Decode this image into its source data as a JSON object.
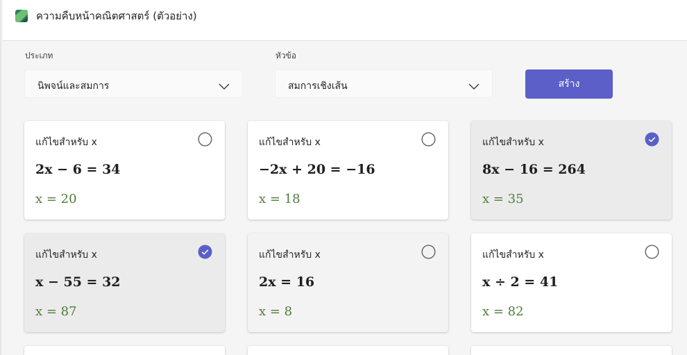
{
  "app": {
    "title": "ความคืบหน้าคณิตศาสตร์ (ตัวอย่าง)",
    "icon": "app-logo-icon"
  },
  "filters": {
    "type_label": "ประเภท",
    "type_value": "นิพจน์และสมการ",
    "topic_label": "หัวข้อ",
    "topic_value": "สมการเชิงเส้น",
    "create_label": "สร้าง"
  },
  "colors": {
    "accent": "#5b5fc7",
    "answer": "#4f7a3a",
    "selected_card": "#ebebeb"
  },
  "cards": [
    {
      "title": "แก้ไขสำหรับ x",
      "equation": "2x − 6 = 34",
      "answer": "x = 20",
      "selected": false
    },
    {
      "title": "แก้ไขสำหรับ x",
      "equation": "−2x + 20 = −16",
      "answer": "x = 18",
      "selected": false
    },
    {
      "title": "แก้ไขสำหรับ x",
      "equation": "8x − 16 = 264",
      "answer": "x = 35",
      "selected": true
    },
    {
      "title": "แก้ไขสำหรับ x",
      "equation": "x − 55 = 32",
      "answer": "x = 87",
      "selected": true
    },
    {
      "title": "แก้ไขสำหรับ x",
      "equation": "2x = 16",
      "answer": "x = 8",
      "selected": false
    },
    {
      "title": "แก้ไขสำหรับ x",
      "equation": "x ÷ 2 = 41",
      "answer": "x = 82",
      "selected": false
    }
  ]
}
